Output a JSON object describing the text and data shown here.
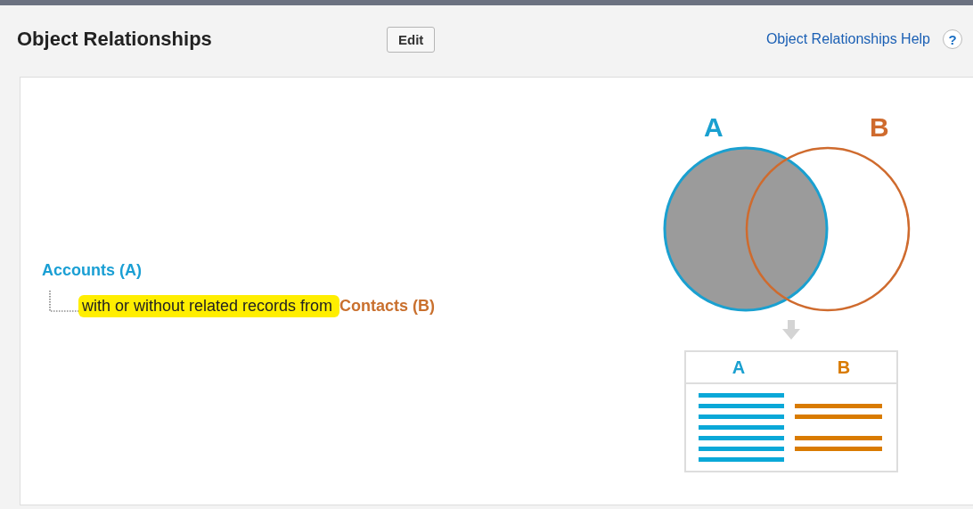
{
  "header": {
    "title": "Object Relationships",
    "edit_button": "Edit",
    "help_link": "Object Relationships Help",
    "help_icon": "?"
  },
  "relationship": {
    "primary": "Accounts (A)",
    "relation": "with or without related records from",
    "highlighted": true,
    "secondary": "Contacts (B)"
  },
  "diagram": {
    "label_a": "A",
    "label_b": "B",
    "table_header_a": "A",
    "table_header_b": "B"
  }
}
